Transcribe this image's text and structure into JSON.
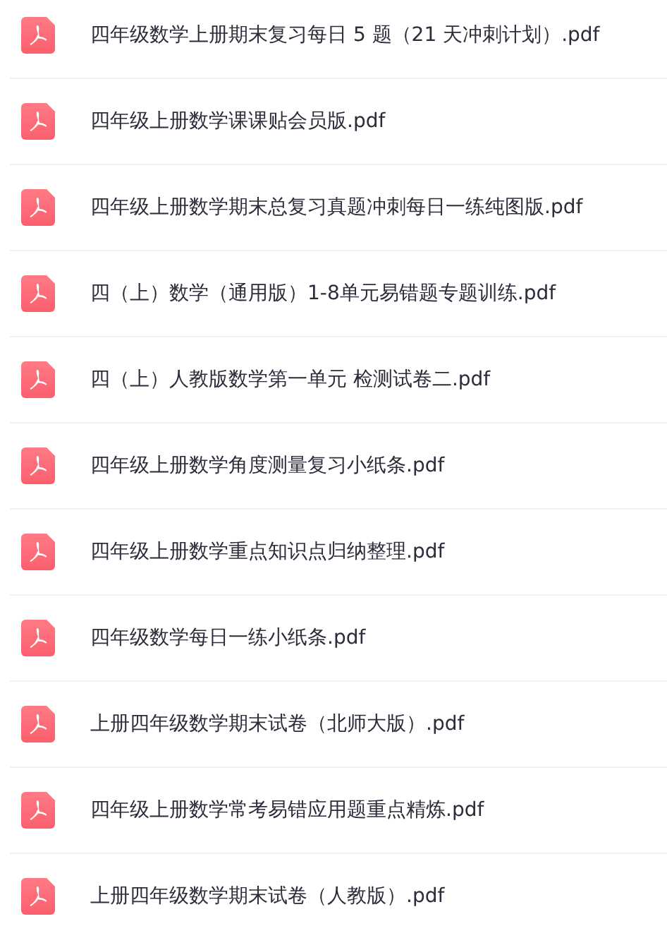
{
  "files": [
    {
      "name": "四年级数学上册期末复习每日 5 题（21 天冲刺计划）.pdf"
    },
    {
      "name": "四年级上册数学课课贴会员版.pdf"
    },
    {
      "name": "四年级上册数学期末总复习真题冲刺每日一练纯图版.pdf"
    },
    {
      "name": "四（上）数学（通用版）1-8单元易错题专题训练.pdf"
    },
    {
      "name": "四（上）人教版数学第一单元 检测试卷二.pdf"
    },
    {
      "name": "四年级上册数学角度测量复习小纸条.pdf"
    },
    {
      "name": "四年级上册数学重点知识点归纳整理.pdf"
    },
    {
      "name": "四年级数学每日一练小纸条.pdf"
    },
    {
      "name": "上册四年级数学期末试卷（北师大版）.pdf"
    },
    {
      "name": "四年级上册数学常考易错应用题重点精炼.pdf"
    },
    {
      "name": "上册四年级数学期末试卷（人教版）.pdf"
    }
  ]
}
